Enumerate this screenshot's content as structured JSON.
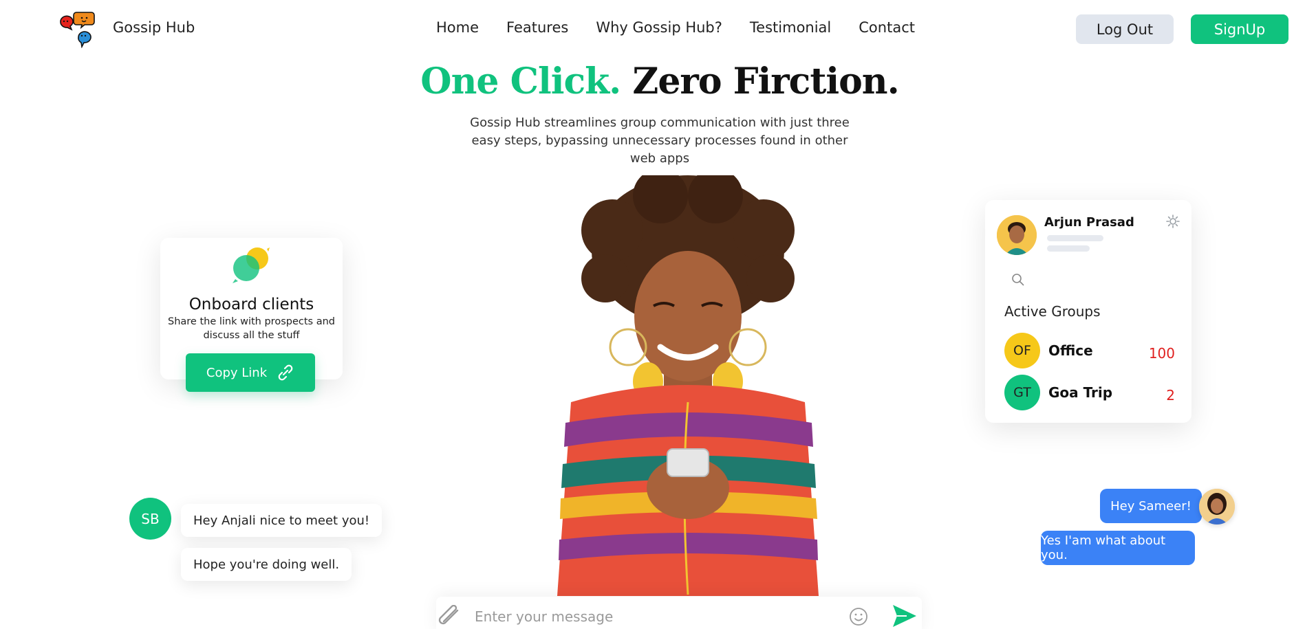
{
  "brand": {
    "name": "Gossip Hub",
    "logo_icon": "chat-bubbles-logo-icon"
  },
  "nav": {
    "items": [
      {
        "label": "Home"
      },
      {
        "label": "Features"
      },
      {
        "label": "Why Gossip Hub?"
      },
      {
        "label": "Testimonial"
      },
      {
        "label": "Contact"
      }
    ]
  },
  "auth": {
    "logout_label": "Log Out",
    "signup_label": "SignUp"
  },
  "hero": {
    "headline_green": "One Click.",
    "headline_dark": "Zero Firction.",
    "subtitle": "Gossip Hub streamlines group communication with just three easy steps, bypassing unnecessary processes found in other web apps"
  },
  "onboard": {
    "title": "Onboard clients",
    "description": "Share the link with prospects and discuss all the stuff",
    "button_label": "Copy Link"
  },
  "profile": {
    "name": "Arjun Prasad",
    "active_groups_title": "Active Groups",
    "groups": [
      {
        "initials": "OF",
        "name": "Office",
        "count": "100",
        "color": "#f6c819"
      },
      {
        "initials": "GT",
        "name": "Goa Trip",
        "count": "2",
        "color": "#10c27e"
      }
    ]
  },
  "chat": {
    "left_avatar_initials": "SB",
    "left_messages": [
      "Hey Anjali nice to meet you!",
      "Hope you're doing well."
    ],
    "right_messages": [
      "Hey Sameer!",
      "Yes I'am what about you."
    ]
  },
  "composer": {
    "placeholder": "Enter your message"
  },
  "colors": {
    "accent": "#10c27e",
    "blue": "#3b82f6",
    "count_red": "#e0201f"
  }
}
